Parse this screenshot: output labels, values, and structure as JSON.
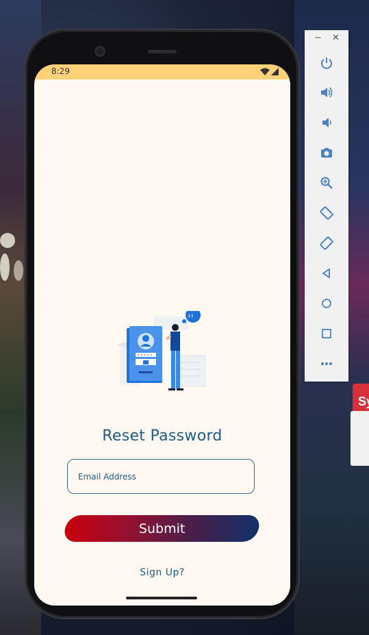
{
  "status_bar": {
    "time": "8:29"
  },
  "screen": {
    "title": "Reset Password",
    "email_placeholder": "Email Address",
    "submit_label": "Submit",
    "signup_link": "Sign Up?"
  },
  "toolbar": {
    "minimize": "−",
    "close": "✕",
    "buttons": [
      "power-icon",
      "volume-up-icon",
      "volume-down-icon",
      "camera-icon",
      "zoom-icon",
      "rotate-left-icon",
      "rotate-right-icon",
      "back-icon",
      "home-icon",
      "overview-icon",
      "more-icon"
    ]
  },
  "colors": {
    "accent": "#1d5c87",
    "status_bar": "#ffd27a",
    "screen_bg": "#fff9f1",
    "gradient_start": "#c8000c",
    "gradient_end": "#12316a"
  },
  "background_sign": {
    "text": "Sy"
  }
}
